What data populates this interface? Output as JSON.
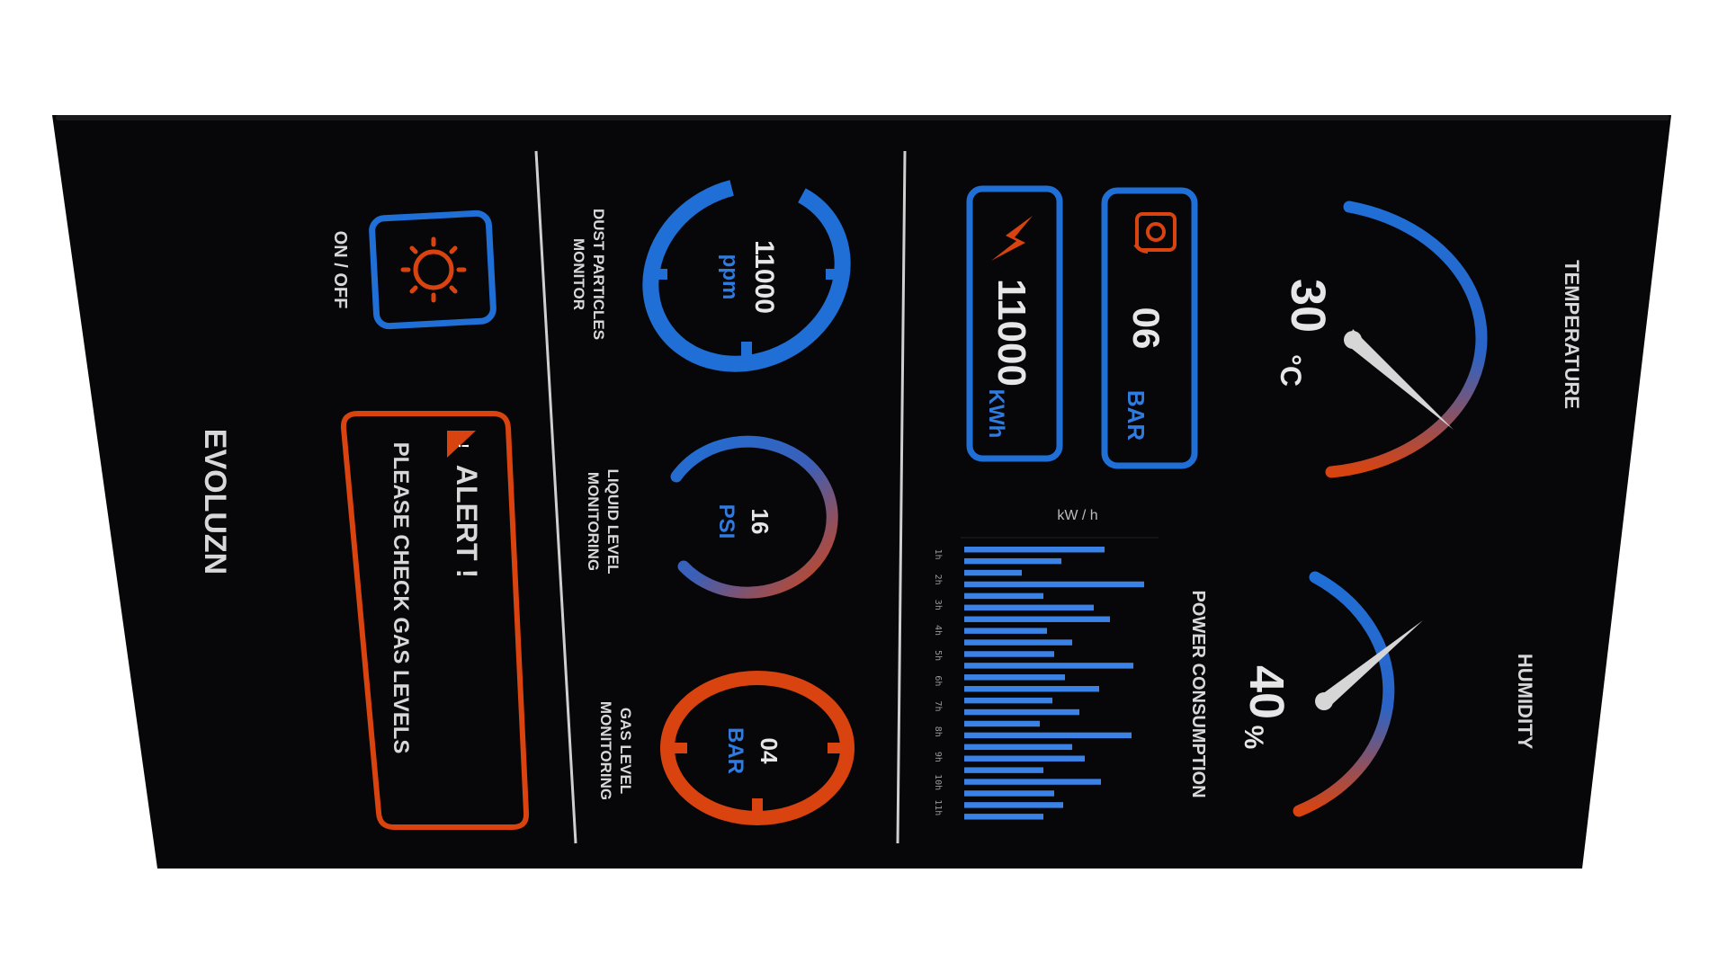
{
  "brand": "EVOLUZN",
  "power_toggle": {
    "label": "ON / OFF",
    "icon": "sun-icon"
  },
  "alert": {
    "title": "ALERT !",
    "message": "PLEASE CHECK GAS LEVELS",
    "icon": "warning-icon",
    "color": "#d9430f"
  },
  "dust": {
    "label_line1": "DUST PARTICLES",
    "label_line2": "MONITOR",
    "value": "11000",
    "unit": "ppm"
  },
  "liquid": {
    "label_line1": "LIQUID LEVEL",
    "label_line2": "MONITORING",
    "value": "16",
    "unit": "PSI"
  },
  "gas": {
    "label_line1": "GAS LEVEL",
    "label_line2": "MONITORING",
    "value": "04",
    "unit": "BAR"
  },
  "energy_card": {
    "value": "11000",
    "unit": "KWh",
    "icon": "lightning-icon"
  },
  "pressure_card": {
    "value": "06",
    "unit": "BAR",
    "icon": "pressure-sensor-icon"
  },
  "temperature": {
    "label": "TEMPERATURE",
    "value": "30",
    "unit": "°C"
  },
  "humidity": {
    "label": "HUMIDITY",
    "value": "40",
    "unit": "%"
  },
  "power_chart": {
    "title": "POWER CONSUMPTION",
    "unit_label": "kW / h",
    "ticks": [
      "1h",
      "2h",
      "3h",
      "4h",
      "5h",
      "6h",
      "7h",
      "8h",
      "9h",
      "10h",
      "11h"
    ]
  },
  "chart_data": {
    "type": "bar",
    "title": "POWER CONSUMPTION",
    "ylabel": "kW / h",
    "categories": [
      "1h",
      "2h",
      "3h",
      "4h",
      "5h",
      "6h",
      "7h",
      "8h",
      "9h",
      "10h",
      "11h"
    ],
    "values": [
      0.78,
      0.54,
      0.32,
      1.0,
      0.44,
      0.72,
      0.81,
      0.46,
      0.6,
      0.5,
      0.94,
      0.56,
      0.75,
      0.49,
      0.64,
      0.42,
      0.93,
      0.6,
      0.67,
      0.44,
      0.76,
      0.5,
      0.55,
      0.44
    ]
  },
  "colors": {
    "accent_blue": "#1f6fd6",
    "accent_orange": "#d9430f",
    "background": "#070709"
  }
}
